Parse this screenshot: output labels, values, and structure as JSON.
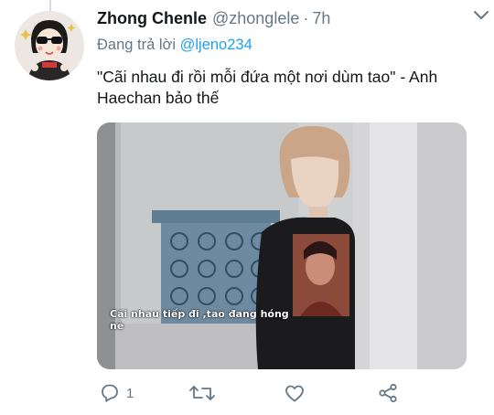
{
  "tweet": {
    "display_name": "Zhong Chenle",
    "handle": "@zhonglele",
    "separator": "·",
    "time": "7h",
    "reply_prefix": "Đang trả lời",
    "reply_to": "@ljeno234",
    "text": "\"Cãi nhau đi rồi mỗi đứa một nơi dùm tao\" - Anh Haechan bảo thế",
    "media": {
      "caption": "Cãi nhau tiếp đi ,tao đang hóng nè"
    },
    "actions": {
      "reply_count": "1",
      "retweet_count": "",
      "like_count": ""
    }
  },
  "colors": {
    "accent": "#1da1f2",
    "secondary_text": "#657786",
    "icon": "#657786"
  },
  "icons": [
    "more-icon",
    "reply-icon",
    "retweet-icon",
    "like-icon",
    "share-icon"
  ]
}
